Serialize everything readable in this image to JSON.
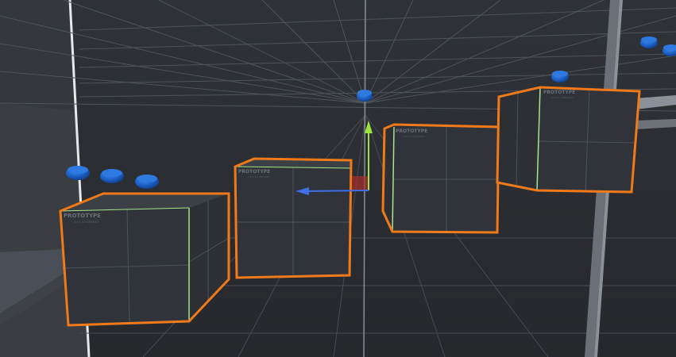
{
  "scene": {
    "prototype_label": "PROTOTYPE",
    "prototype_sublabel": "1.5 x 1.5 DEFAULT",
    "colors": {
      "background": "#2b2d31",
      "grid": "#5a5e66",
      "selection_outline": "#f07a1a",
      "cube_face": "#30343a",
      "cube_top": "#3b4046",
      "gizmo_y": "#9be33d",
      "gizmo_x": "#3f6ee8",
      "gizmo_z": "#b0302a",
      "sphere": "#1c5ec4",
      "edge_highlight": "#a9e38a"
    }
  }
}
